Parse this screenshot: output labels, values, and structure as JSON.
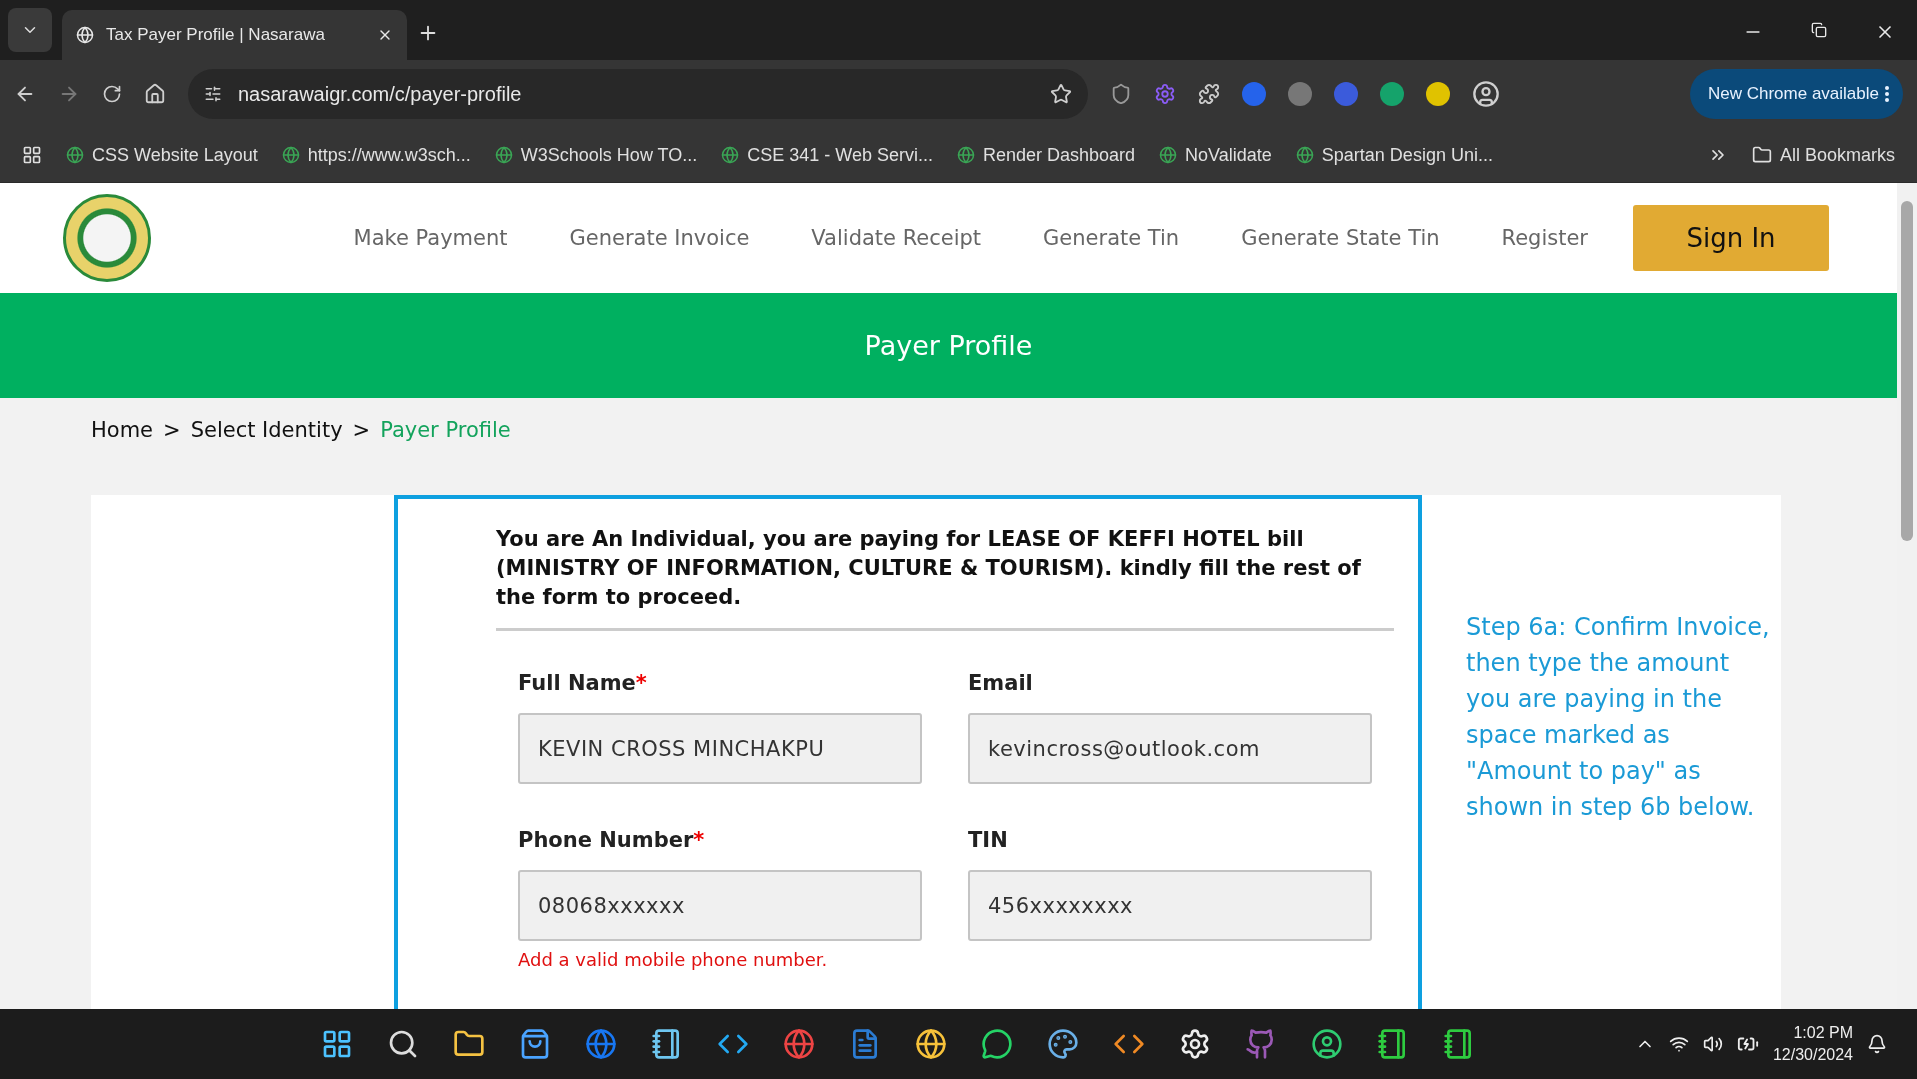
{
  "browser": {
    "tab_title": "Tax Payer Profile | Nasarawa",
    "url": "nasarawaigr.com/c/payer-profile",
    "update_button": "New Chrome available",
    "bookmarks": [
      {
        "label": "CSS Website Layout"
      },
      {
        "label": "https://www.w3sch..."
      },
      {
        "label": "W3Schools How TO..."
      },
      {
        "label": "CSE 341 - Web Servi..."
      },
      {
        "label": "Render Dashboard"
      },
      {
        "label": "NoValidate"
      },
      {
        "label": "Spartan Design Uni..."
      }
    ],
    "all_bookmarks": "All Bookmarks"
  },
  "nav": {
    "items": [
      "Make Payment",
      "Generate Invoice",
      "Validate Receipt",
      "Generate Tin",
      "Generate State Tin",
      "Register"
    ],
    "sign_in": "Sign In"
  },
  "banner": {
    "title": "Payer Profile"
  },
  "breadcrumb": [
    {
      "label": "Home",
      "current": false
    },
    {
      "label": "Select Identity",
      "current": false
    },
    {
      "label": "Payer Profile",
      "current": true
    }
  ],
  "breadcrumb_separator": ">",
  "form": {
    "notice": "You are An Individual, you are paying for LEASE OF KEFFI HOTEL bill (MINISTRY OF INFORMATION, CULTURE & TOURISM). kindly fill the rest of the form to proceed.",
    "fields": [
      {
        "label": "Full Name",
        "required_mark": "*",
        "value": "KEVIN CROSS MINCHAKPU"
      },
      {
        "label": "Email",
        "value": "kevincross@outlook.com"
      },
      {
        "label": "Phone Number",
        "required_mark": "*",
        "value": "08068xxxxxx",
        "error": "Add a valid mobile phone number."
      },
      {
        "label": "TIN",
        "value": "456xxxxxxxx"
      }
    ]
  },
  "side_note": "Step 6a: Confirm Invoice, then type the amount you are paying in the space marked as \"Amount to pay\" as shown in step 6b below.",
  "taskbar": {
    "time": "1:02 PM",
    "date": "12/30/2024"
  }
}
